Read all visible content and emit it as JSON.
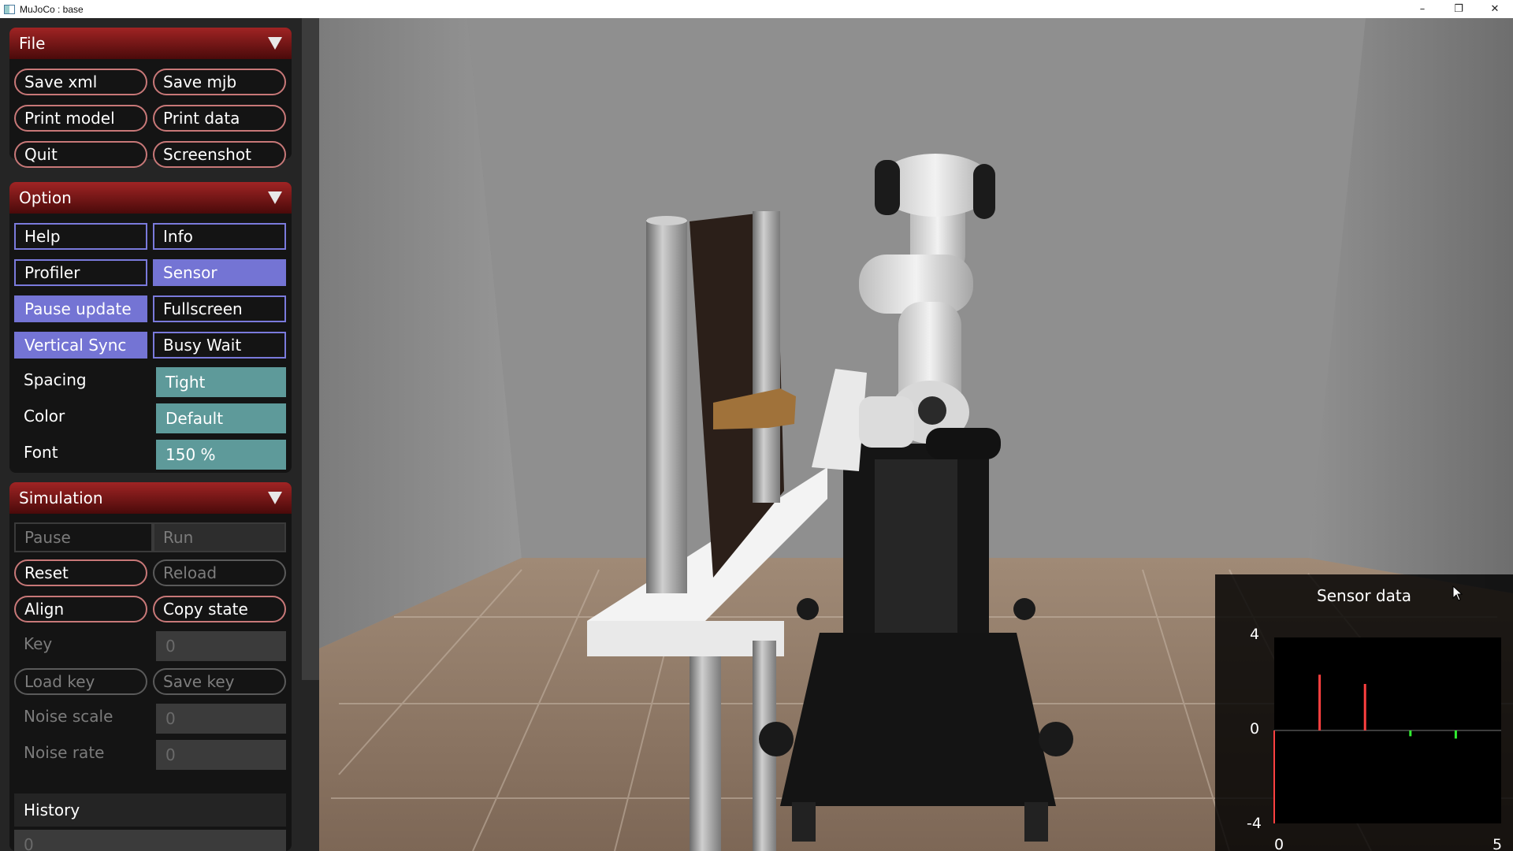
{
  "window": {
    "title": "MuJoCo : base",
    "controls": [
      "minimize-icon",
      "restore-icon",
      "close-icon"
    ]
  },
  "file": {
    "header": "File",
    "buttons": [
      "Save xml",
      "Save mjb",
      "Print model",
      "Print data",
      "Quit",
      "Screenshot"
    ]
  },
  "option": {
    "header": "Option",
    "toggles": [
      {
        "label": "Help",
        "on": false
      },
      {
        "label": "Info",
        "on": false
      },
      {
        "label": "Profiler",
        "on": false
      },
      {
        "label": "Sensor",
        "on": true
      },
      {
        "label": "Pause update",
        "on": true
      },
      {
        "label": "Fullscreen",
        "on": false
      },
      {
        "label": "Vertical Sync",
        "on": true
      },
      {
        "label": "Busy Wait",
        "on": false
      }
    ],
    "spacing_label": "Spacing",
    "spacing_value": "Tight",
    "color_label": "Color",
    "color_value": "Default",
    "font_label": "Font",
    "font_value": "150 %"
  },
  "simulation": {
    "header": "Simulation",
    "pause_label": "Pause",
    "run_label": "Run",
    "reset_label": "Reset",
    "reload_label": "Reload",
    "align_label": "Align",
    "copy_state_label": "Copy state",
    "key_label": "Key",
    "key_value": "0",
    "load_key_label": "Load key",
    "save_key_label": "Save key",
    "noise_scale_label": "Noise scale",
    "noise_scale_value": "0",
    "noise_rate_label": "Noise rate",
    "noise_rate_value": "0",
    "history_label": "History",
    "history_value": "0"
  },
  "sensor_plot": {
    "title": "Sensor data",
    "y_ticks": [
      "4",
      "0",
      "-4"
    ],
    "x_ticks": [
      "0",
      "5"
    ]
  },
  "chart_data": {
    "type": "bar",
    "title": "Sensor data",
    "xlim": [
      0,
      5
    ],
    "ylim": [
      -4,
      4
    ],
    "bars": [
      {
        "x": 1,
        "value": 2.4,
        "color": "#ff4040"
      },
      {
        "x": 2,
        "value": 2.0,
        "color": "#ff4040"
      },
      {
        "x": 3,
        "value": -0.25,
        "color": "#30ee30"
      },
      {
        "x": 4,
        "value": -0.35,
        "color": "#30ee30"
      }
    ]
  },
  "colors": {
    "header_red": "#a02424",
    "toggle_on": "#7474d4",
    "field_teal": "#5e9a9a"
  }
}
